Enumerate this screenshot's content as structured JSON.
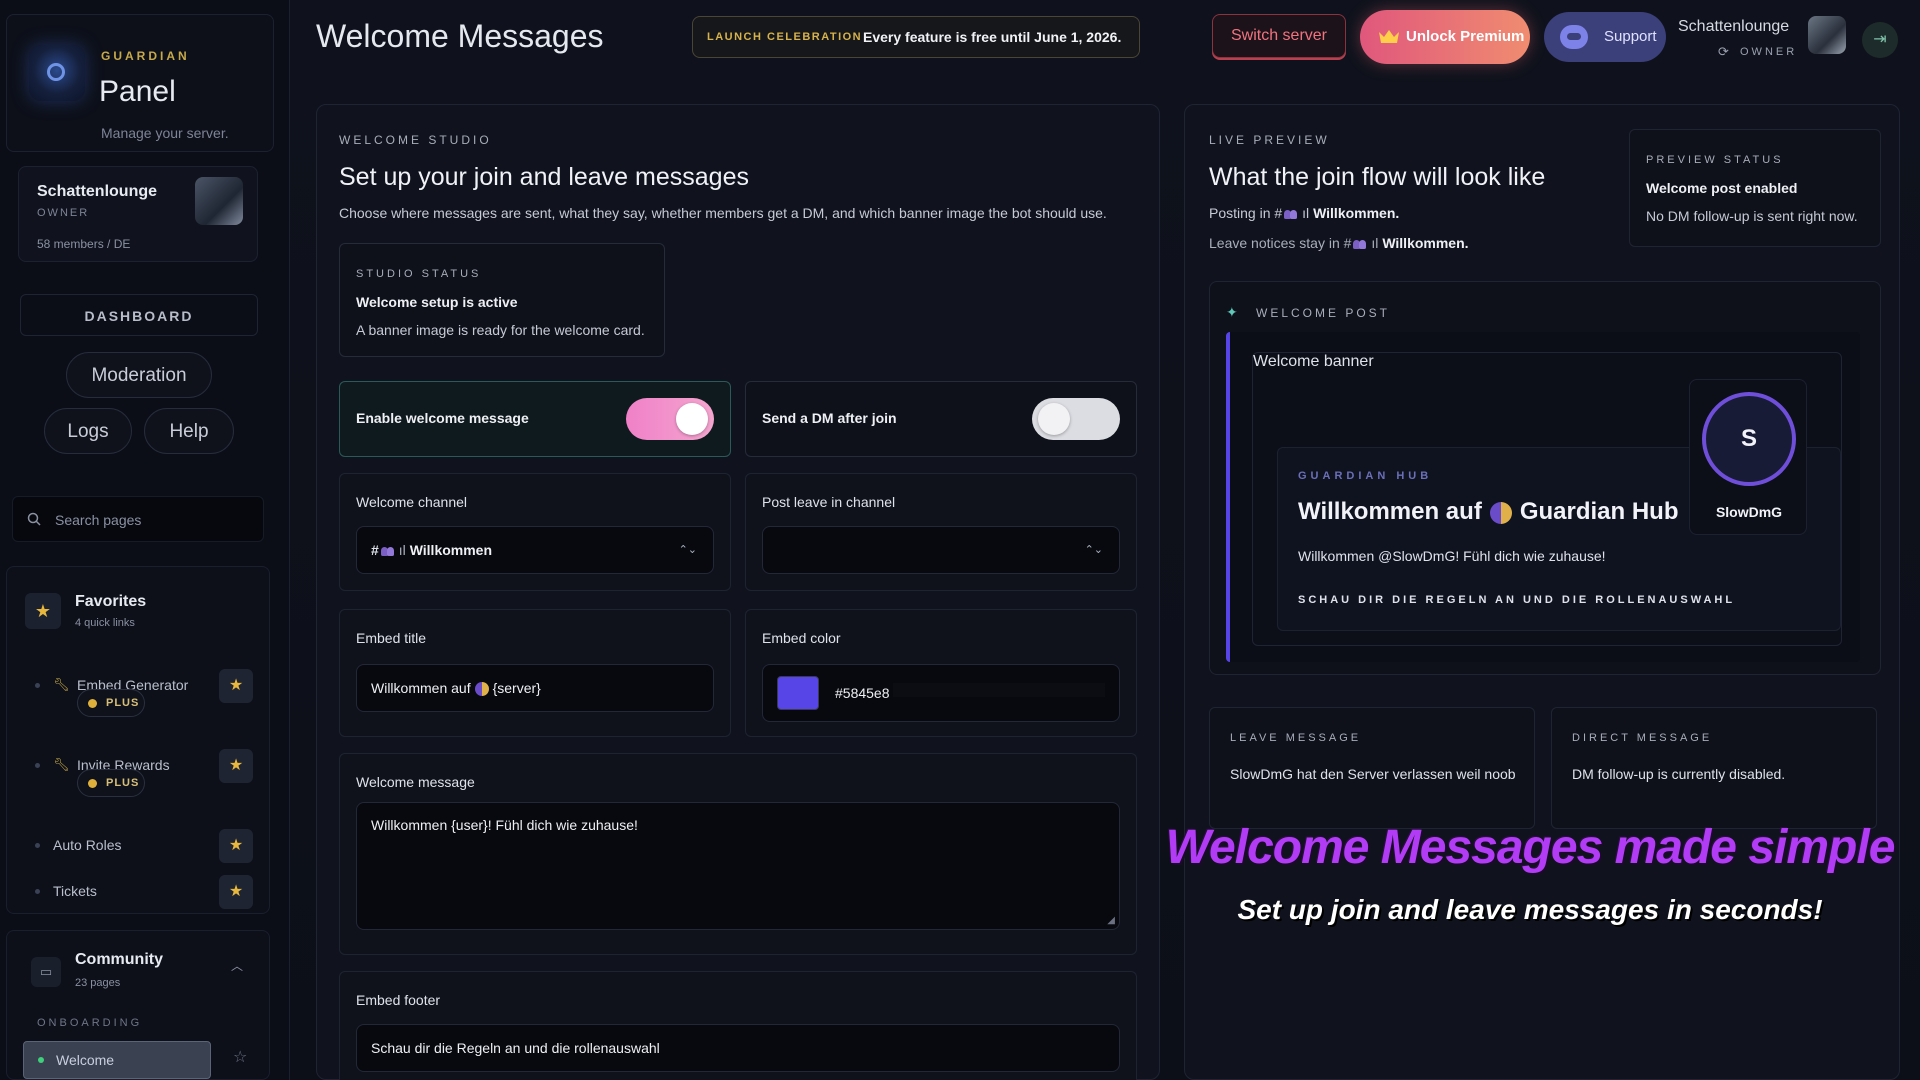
{
  "brand": {
    "kicker": "GUARDIAN",
    "title": "Panel",
    "subtitle": "Manage your server."
  },
  "server": {
    "name": "Schattenlounge",
    "role": "OWNER",
    "meta": "58 members / DE"
  },
  "nav": {
    "dashboard": "DASHBOARD",
    "moderation": "Moderation",
    "logs": "Logs",
    "help": "Help"
  },
  "search": {
    "placeholder": "Search pages"
  },
  "favorites": {
    "title": "Favorites",
    "subtitle": "4 quick links",
    "items": [
      {
        "label": "Embed Generator",
        "badge": "PLUS"
      },
      {
        "label": "Invite Rewards",
        "badge": "PLUS"
      },
      {
        "label": "Auto Roles"
      },
      {
        "label": "Tickets"
      }
    ]
  },
  "community": {
    "title": "Community",
    "subtitle": "23 pages",
    "section": "ONBOARDING",
    "active_item": "Welcome"
  },
  "header": {
    "title": "Welcome Messages",
    "launch_tag": "LAUNCH CELEBRATION",
    "launch_text": "Every feature is free until June 1, 2026.",
    "switch_server": "Switch server",
    "unlock_premium": "Unlock Premium",
    "support": "Support",
    "user_name": "Schattenlounge",
    "user_role": "OWNER"
  },
  "studio": {
    "kicker": "WELCOME STUDIO",
    "heading": "Set up your join and leave messages",
    "description": "Choose where messages are sent, what they say, whether members get a DM, and which banner image the bot should use.",
    "status_kicker": "STUDIO STATUS",
    "status_title": "Welcome setup is active",
    "status_text": "A banner image is ready for the welcome card.",
    "enable_welcome_label": "Enable welcome message",
    "enable_welcome_on": true,
    "send_dm_label": "Send a DM after join",
    "send_dm_on": false,
    "welcome_channel_label": "Welcome channel",
    "welcome_channel_value": "Willkommen",
    "leave_channel_label": "Post leave in channel",
    "leave_channel_value": "",
    "embed_title_label": "Embed title",
    "embed_title_prefix": "Willkommen auf",
    "embed_title_suffix": "{server}",
    "embed_color_label": "Embed color",
    "embed_color_value": "#5845e8",
    "welcome_message_label": "Welcome message",
    "welcome_message_value": "Willkommen {user}! Fühl dich wie zuhause!",
    "embed_footer_label": "Embed footer",
    "embed_footer_value": "Schau dir die Regeln an und die rollenauswahl"
  },
  "preview": {
    "kicker": "LIVE PREVIEW",
    "heading": "What the join flow will look like",
    "posting_prefix": "Posting in #",
    "posting_channel": "Willkommen.",
    "leave_prefix": "Leave notices stay in #",
    "leave_channel": "Willkommen.",
    "status_kicker": "PREVIEW STATUS",
    "status_title": "Welcome post enabled",
    "status_text": "No DM follow-up is sent right now.",
    "post_kicker": "WELCOME POST",
    "banner_alt": "Welcome banner",
    "hub_kicker": "GUARDIAN HUB",
    "hub_title_prefix": "Willkommen auf",
    "hub_title_suffix": "Guardian Hub",
    "hub_desc": "Willkommen @SlowDmG! Fühl dich wie zuhause!",
    "hub_footer": "SCHAU DIR DIE REGELN AN UND DIE ROLLENAUSWAHL",
    "avatar_letter": "S",
    "avatar_name": "SlowDmG",
    "leave_kicker": "LEAVE MESSAGE",
    "leave_text": "SlowDmG hat den Server verlassen weil noob",
    "dm_kicker": "DIRECT MESSAGE",
    "dm_text": "DM follow-up is currently disabled."
  },
  "promo": {
    "headline": "Welcome Messages made simple",
    "subline": "Set up join and leave messages in seconds!"
  },
  "colors": {
    "accent": "#5845e8",
    "gold": "#e0b13a",
    "toggle_on": "#f080c8"
  }
}
